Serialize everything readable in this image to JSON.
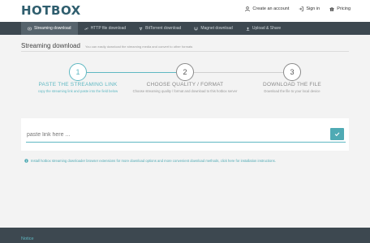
{
  "app": {
    "logo_text": "HOTBOX",
    "accent_color": "#5fb8c2",
    "nav_bg": "#3d4850"
  },
  "header": {
    "links": [
      {
        "label": "Create an account",
        "icon": "user-icon"
      },
      {
        "label": "Sign in",
        "icon": "sign-in-icon"
      },
      {
        "label": "Pricing",
        "icon": "gift-icon"
      }
    ]
  },
  "nav": {
    "items": [
      {
        "label": "Streaming download",
        "icon": "stream-icon",
        "active": true
      },
      {
        "label": "HTTP file download",
        "icon": "link-icon",
        "active": false
      },
      {
        "label": "BitTorrent download",
        "icon": "torrent-icon",
        "active": false
      },
      {
        "label": "Magnet download",
        "icon": "magnet-icon",
        "active": false
      },
      {
        "label": "Upload & Share",
        "icon": "upload-icon",
        "active": false
      }
    ]
  },
  "page": {
    "title": "Streaming download",
    "subtitle": "You can easily download the streaming media and convert to other formats"
  },
  "steps": [
    {
      "number": "1",
      "title": "PASTE THE STREAMING LINK",
      "description": "copy the streaming link and paste into the field below",
      "active": true
    },
    {
      "number": "2",
      "title": "CHOOSE QUALITY / FORMAT",
      "description": "Choose streaming quality / format and download to this hotbox server",
      "active": false
    },
    {
      "number": "3",
      "title": "DOWNLOAD THE FILE",
      "description": "Download the file to your local device",
      "active": false
    }
  ],
  "form": {
    "placeholder": "paste link here ...",
    "value": "",
    "submit_icon": "check-icon"
  },
  "info": {
    "text": "Install hotbox streaming downloader browser extensions for more download options and more convenient download methods, click here for installation instructions.",
    "icon": "info-circle-icon"
  },
  "footer": {
    "notice_label": "Notice"
  }
}
